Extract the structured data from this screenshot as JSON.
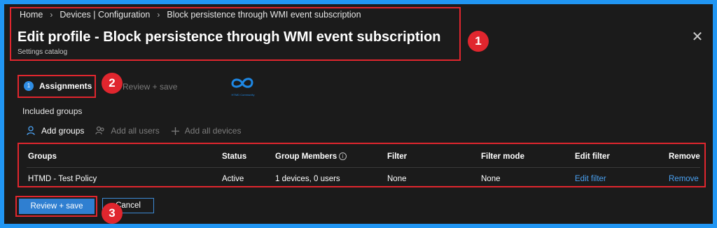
{
  "breadcrumb": [
    "Home",
    "Devices | Configuration",
    "Block persistence through WMI event subscription"
  ],
  "page": {
    "title": "Edit profile - Block persistence through WMI event subscription",
    "subtitle": "Settings catalog",
    "close_icon": "close-icon"
  },
  "steps": {
    "assignments": {
      "number": "1",
      "label": "Assignments"
    },
    "review": {
      "label": "Review + save"
    }
  },
  "logo_text": "HTMD Community",
  "section": {
    "included_groups": "Included groups"
  },
  "actions": [
    {
      "label": "Add groups",
      "icon": "person-add-icon",
      "enabled": true
    },
    {
      "label": "Add all users",
      "icon": "users-icon",
      "enabled": false
    },
    {
      "label": "Add all devices",
      "icon": "plus-icon",
      "enabled": false
    }
  ],
  "table": {
    "headers": [
      "Groups",
      "Status",
      "Group Members",
      "Filter",
      "Filter mode",
      "Edit filter",
      "Remove"
    ],
    "rows": [
      [
        "HTMD - Test Policy",
        "Active",
        "1 devices, 0 users",
        "None",
        "None",
        "Edit filter",
        "Remove"
      ]
    ]
  },
  "footer": {
    "review_save": "Review + save",
    "cancel": "Cancel"
  },
  "callouts": [
    "1",
    "2",
    "3"
  ],
  "colors": {
    "accent": "#2f7fd1",
    "highlight": "#e0262e",
    "link": "#4aa0f0",
    "frame": "#2196f3",
    "background": "#1b1b1b"
  }
}
